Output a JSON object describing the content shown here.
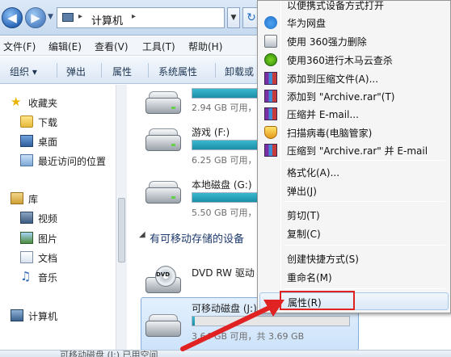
{
  "address_bar": {
    "crumbs": [
      "计算机"
    ]
  },
  "menubar": {
    "items": [
      "文件(F)",
      "编辑(E)",
      "查看(V)",
      "工具(T)",
      "帮助(H)"
    ]
  },
  "toolbar": {
    "items": [
      "组织",
      "弹出",
      "属性",
      "系统属性",
      "卸载或"
    ]
  },
  "nav_pane": {
    "favorites_label": "收藏夹",
    "favorites": [
      "下载",
      "桌面",
      "最近访问的位置"
    ],
    "libraries_label": "库",
    "libraries": [
      "视频",
      "图片",
      "文档",
      "音乐"
    ],
    "computer_label": "计算机"
  },
  "content": {
    "drives": [
      {
        "name": "",
        "size_text": "2.94 GB 可用，",
        "used_fraction": 0.79
      },
      {
        "name": "游戏 (F:)",
        "size_text": "6.25 GB 可用，",
        "used_fraction": 0.8
      },
      {
        "name": "本地磁盘 (G:)",
        "size_text": "5.50 GB 可用，",
        "used_fraction": 0.5
      }
    ],
    "removable_group_label": "有可移动存储的设备",
    "dvd_name": "DVD RW 驱动",
    "usb": {
      "name": "可移动磁盘 (J:)",
      "size_text": "3.64 GB 可用，共 3.69 GB",
      "used_fraction": 0.014
    }
  },
  "details": {
    "text": "可移动磁盘 (J:) 已用空间"
  },
  "context_menu": {
    "items": [
      {
        "label": "以便携式设备方式打开",
        "icon": "none"
      },
      {
        "label": "华为网盘",
        "icon": "cloud-icon"
      },
      {
        "label": "使用 360强力删除",
        "icon": "shredder-icon"
      },
      {
        "label": "使用360进行木马云查杀",
        "icon": "360-security-icon"
      },
      {
        "label": "添加到压缩文件(A)...",
        "icon": "winrar-icon"
      },
      {
        "label": "添加到 \"Archive.rar\"(T)",
        "icon": "winrar-icon"
      },
      {
        "label": "压缩并 E-mail...",
        "icon": "winrar-icon"
      },
      {
        "label": "扫描病毒(电脑管家)",
        "icon": "shield-icon"
      },
      {
        "label": "压缩到 \"Archive.rar\" 并 E-mail",
        "icon": "winrar-icon"
      },
      {
        "label": "格式化(A)...",
        "icon": "none"
      },
      {
        "label": "弹出(J)",
        "icon": "none"
      },
      {
        "label": "剪切(T)",
        "icon": "none"
      },
      {
        "label": "复制(C)",
        "icon": "none"
      },
      {
        "label": "创建快捷方式(S)",
        "icon": "none"
      },
      {
        "label": "重命名(M)",
        "icon": "none"
      },
      {
        "label": "属性(R)",
        "icon": "none"
      }
    ]
  },
  "annotation": {
    "highlight_color": "#e02222"
  }
}
